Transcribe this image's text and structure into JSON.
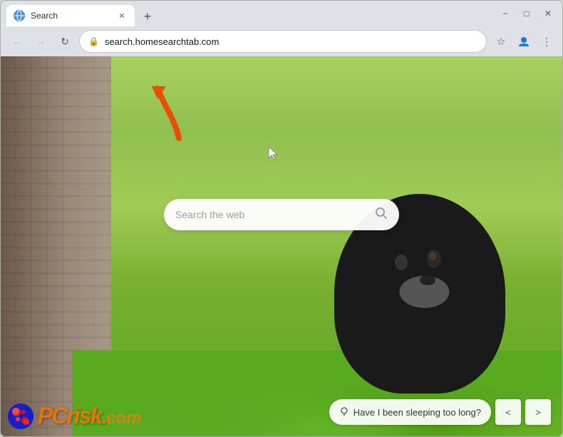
{
  "browser": {
    "tab": {
      "title": "Search",
      "favicon_label": "globe-icon"
    },
    "new_tab_label": "+",
    "window_controls": {
      "minimize": "−",
      "maximize": "□",
      "close": "✕"
    },
    "nav": {
      "back_label": "←",
      "forward_label": "→",
      "reload_label": "↻",
      "address": "search.homesearchtab.com",
      "bookmark_label": "☆",
      "profile_label": "👤",
      "menu_label": "⋮"
    }
  },
  "page": {
    "search_placeholder": "Search the web",
    "search_icon": "🔍"
  },
  "bottom": {
    "suggestion_icon": "📍",
    "suggestion_text": "Have I been sleeping too long?",
    "prev_label": "<",
    "next_label": ">"
  },
  "logo": {
    "text": "PC",
    "domain": "risk.com"
  },
  "colors": {
    "accent_orange": "#ff7800",
    "browser_bg": "#dee1e6",
    "tab_active": "#ffffff",
    "address_bar_bg": "#ffffff",
    "search_bar_bg": "rgba(255,255,255,0.95)",
    "arrow_color": "#ff6600"
  }
}
